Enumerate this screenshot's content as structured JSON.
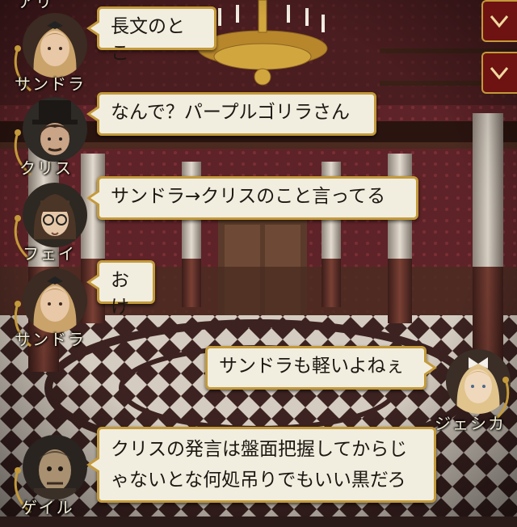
{
  "messages": [
    {
      "speaker": "",
      "text": "長文のとこ",
      "side": "left"
    },
    {
      "speaker": "サンドラ",
      "text": "なんで？パープルゴリラさん",
      "side": "left"
    },
    {
      "speaker": "クリス",
      "text": "サンドラ→クリスのこと言ってる",
      "side": "left"
    },
    {
      "speaker": "フェイ",
      "text": "おけ",
      "side": "left"
    },
    {
      "speaker": "サンドラ",
      "text": "",
      "side": "left"
    },
    {
      "speaker": "",
      "text": "サンドラも軽いよねぇ",
      "side": "right"
    },
    {
      "speaker": "ジェシカ",
      "text": "",
      "side": "right"
    },
    {
      "speaker": "",
      "text": "クリスの発言は盤面把握してからじゃないとな何処吊りでもいい黒だろ",
      "side": "left"
    },
    {
      "speaker": "ゲイル",
      "text": "",
      "side": "left"
    }
  ],
  "chat": {
    "m1_text": "長文のとこ",
    "m1_speaker": "サンドラ",
    "m2_text": "なんで？パープルゴリラさん",
    "m2_speaker": "クリス",
    "m3_text": "サンドラ→クリスのこと言ってる",
    "m3_speaker": "フェイ",
    "m4_text": "おけ",
    "m4_speaker": "サンドラ",
    "m5_text": "サンドラも軽いよねぇ",
    "m5_speaker": "ジェシカ",
    "m6_line1": "クリスの発言は盤面把握してからじ",
    "m6_line2": "ゃないとな何処吊りでもいい黒だろ",
    "m6_speaker": "ゲイル",
    "top_partial_speaker": "アリ"
  },
  "controls": {
    "scroll_icons": [
      "chevron-down-icon",
      "chevron-down-icon"
    ],
    "accent": "#6e1212"
  },
  "colors": {
    "bubble_fill": "#f2eedf",
    "bubble_border": "#c49a3a",
    "wall": "#5a2226",
    "pillar": "#bdb3a6",
    "floor_dark": "#3b2522",
    "floor_light": "#d8cfc4"
  }
}
